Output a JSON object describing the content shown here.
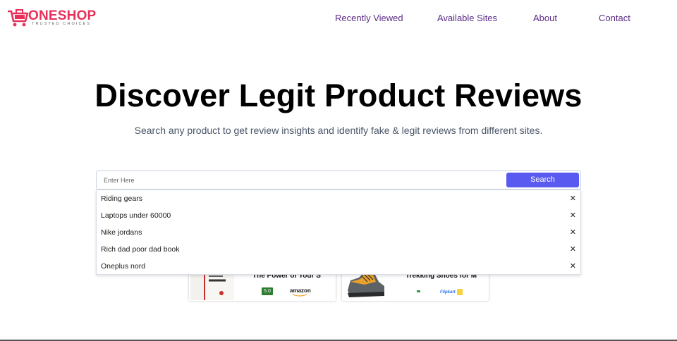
{
  "brand": {
    "name": "ONESHOP",
    "tagline": "TRUSTED CHOICES",
    "accent": "#e8305a"
  },
  "nav": {
    "recently_viewed": "Recently Viewed",
    "available_sites": "Available Sites",
    "about": "About",
    "contact": "Contact",
    "color": "#5b2c87"
  },
  "hero": {
    "title": "Discover Legit Product Reviews",
    "subtitle": "Search any product to get review insights and identify fake & legit reviews from different sites."
  },
  "search": {
    "placeholder": "Enter Here",
    "button_label": "Search",
    "button_color": "#5a5af0"
  },
  "suggestions": [
    {
      "label": "Riding gears",
      "close": "✕"
    },
    {
      "label": "Laptops under 60000",
      "close": "✕"
    },
    {
      "label": "Nike jordans",
      "close": "✕"
    },
    {
      "label": "Rich dad poor dad book",
      "close": "✕"
    },
    {
      "label": "Oneplus nord",
      "close": "✕"
    }
  ],
  "cards": [
    {
      "title": "The Power of Your S",
      "rating": "5.0",
      "store": "amazon"
    },
    {
      "title": "Trekking Shoes for M",
      "store": "Flipkart"
    }
  ]
}
